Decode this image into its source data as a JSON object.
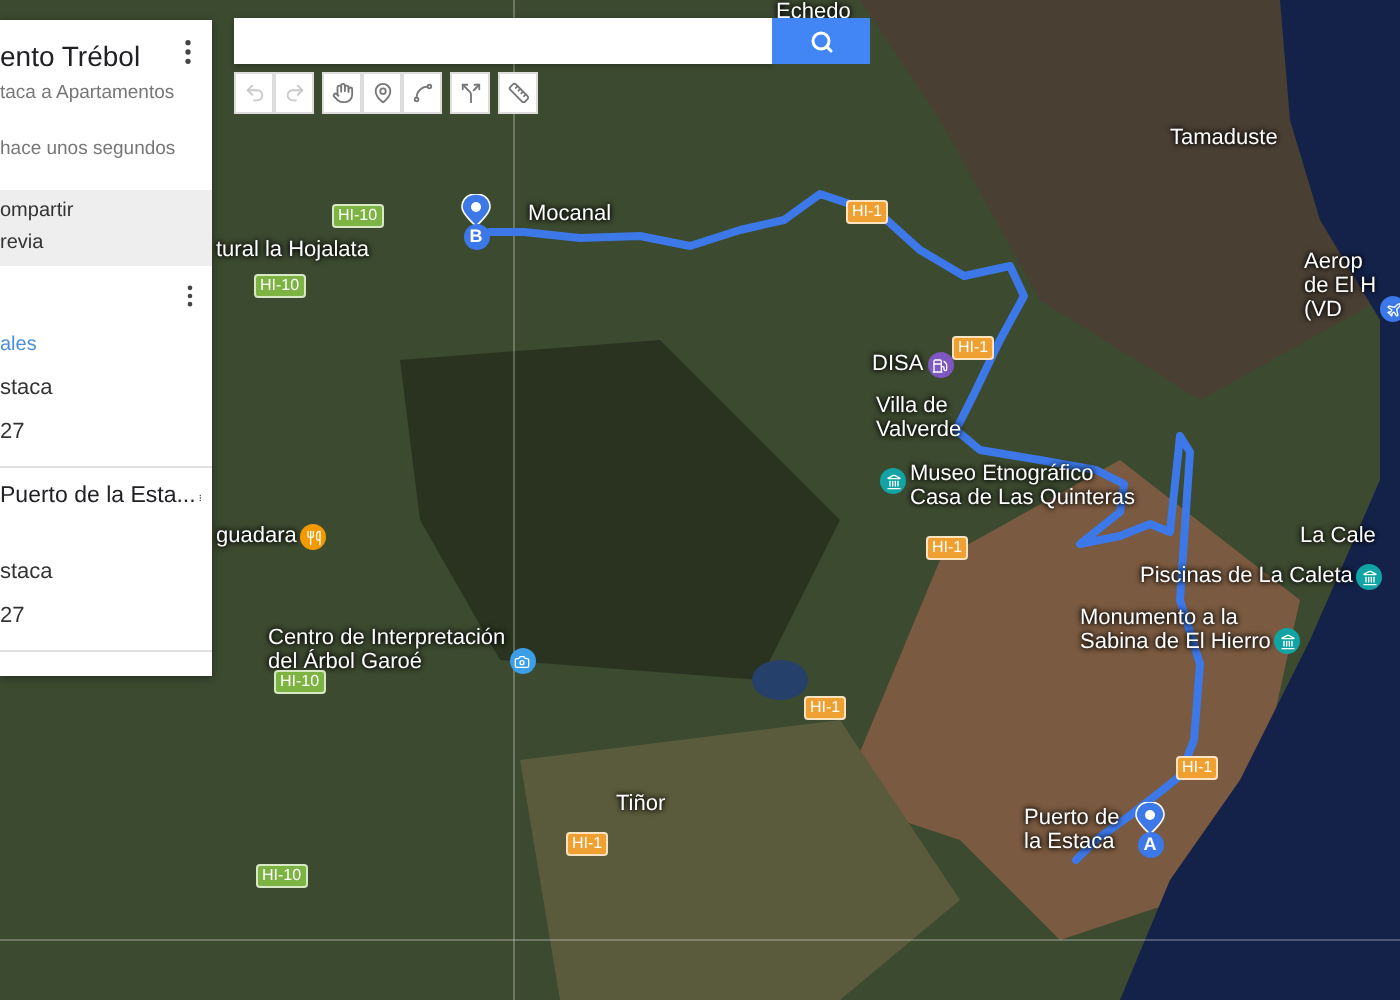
{
  "left_panel": {
    "title": "ento Trébol",
    "subtitle": "taca a Apartamentos",
    "saved_status": "hace unos segundos",
    "actions": [
      "ompartir",
      "revia"
    ],
    "layers": [
      {
        "link": "ales",
        "items": [
          "staca",
          "27"
        ]
      },
      {
        "title": "Puerto de la Esta...",
        "items": [
          "staca",
          "27"
        ]
      }
    ]
  },
  "toolbar": [
    {
      "kind": "undo",
      "disabled": true
    },
    {
      "kind": "redo",
      "disabled": true
    },
    {
      "kind": "hand",
      "disabled": false
    },
    {
      "kind": "marker",
      "disabled": false
    },
    {
      "kind": "line",
      "disabled": false
    },
    {
      "kind": "directions",
      "disabled": false
    },
    {
      "kind": "ruler",
      "disabled": false
    }
  ],
  "map": {
    "labels": [
      {
        "kind": "place",
        "lines": [
          "Echedo"
        ]
      },
      {
        "kind": "road",
        "lines": [
          "HI-10"
        ],
        "color": "#7cb342"
      },
      {
        "kind": "place",
        "lines": [
          "Mocanal"
        ]
      },
      {
        "kind": "place",
        "lines": [
          "tural la Hojalata"
        ]
      },
      {
        "kind": "road",
        "lines": [
          "HI-10"
        ],
        "color": "#7cb342"
      },
      {
        "kind": "road",
        "lines": [
          "HI-1"
        ],
        "color": "#f0a030"
      },
      {
        "kind": "fuel",
        "lines": [
          "DISA"
        ]
      },
      {
        "kind": "road",
        "lines": [
          "HI-1"
        ],
        "color": "#f0a030"
      },
      {
        "kind": "place",
        "lines": [
          "Villa de",
          "Valverde"
        ]
      },
      {
        "kind": "museum",
        "lines": [
          "Museo Etnográfico",
          "Casa de Las Quinteras"
        ]
      },
      {
        "kind": "road",
        "lines": [
          "HI-1"
        ],
        "color": "#f0a030"
      },
      {
        "kind": "place",
        "lines": [
          "Tamaduste"
        ]
      },
      {
        "kind": "airport",
        "lines": [
          "Aerop",
          "de El H",
          "(VD"
        ]
      },
      {
        "kind": "place",
        "lines": [
          "La Cale"
        ]
      },
      {
        "kind": "landmark",
        "lines": [
          "Piscinas de La Caleta"
        ]
      },
      {
        "kind": "landmark",
        "lines": [
          "Monumento a la",
          "Sabina de El Hierro"
        ]
      },
      {
        "kind": "restaurant",
        "lines": [
          "guadara"
        ]
      },
      {
        "kind": "camera",
        "lines": [
          "Centro de Interpretación",
          "del Árbol Garoé"
        ]
      },
      {
        "kind": "road",
        "lines": [
          "HI-10"
        ],
        "color": "#7cb342"
      },
      {
        "kind": "road",
        "lines": [
          "HI-1"
        ],
        "color": "#f0a030"
      },
      {
        "kind": "place",
        "lines": [
          "Tiñor"
        ]
      },
      {
        "kind": "road",
        "lines": [
          "HI-1"
        ],
        "color": "#f0a030"
      },
      {
        "kind": "road",
        "lines": [
          "HI-10"
        ],
        "color": "#7cb342"
      },
      {
        "kind": "place",
        "lines": [
          "Puerto de",
          "la Estaca"
        ]
      },
      {
        "kind": "road",
        "lines": [
          "HI-1"
        ],
        "color": "#f0a030"
      }
    ],
    "markers": [
      {
        "letter": "B"
      },
      {
        "letter": "A"
      }
    ]
  }
}
